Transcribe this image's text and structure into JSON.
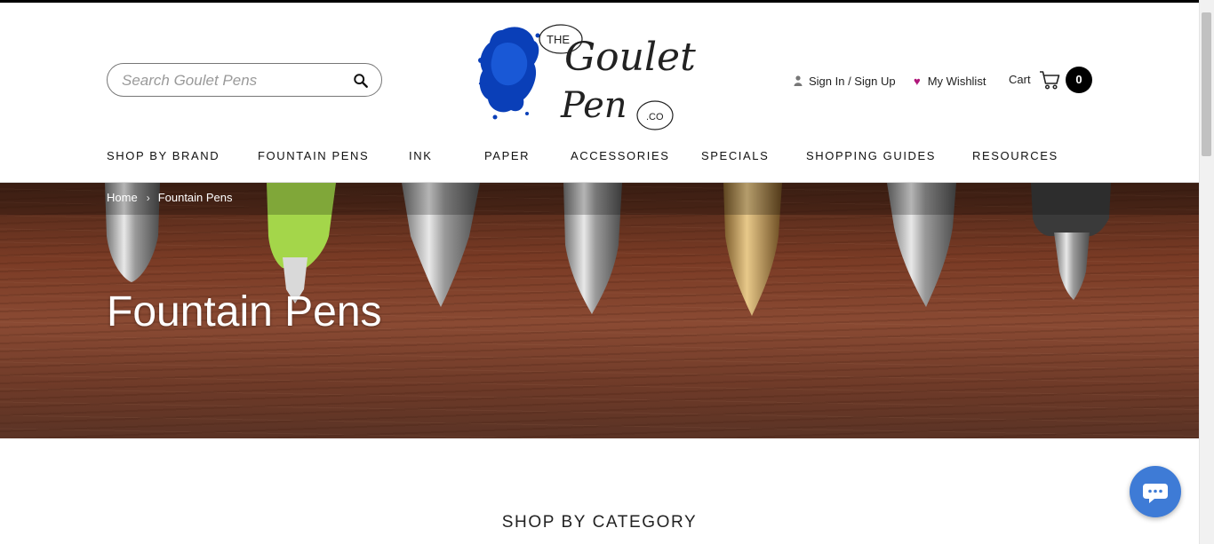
{
  "search": {
    "placeholder": "Search Goulet Pens"
  },
  "logo": {
    "alt": "The Goulet Pen Co"
  },
  "header": {
    "account_label": "Sign In / Sign Up",
    "wishlist_label": "My Wishlist",
    "cart_label": "Cart",
    "cart_count": "0"
  },
  "nav": {
    "items": [
      {
        "label": "SHOP BY BRAND"
      },
      {
        "label": "FOUNTAIN PENS"
      },
      {
        "label": "INK"
      },
      {
        "label": "PAPER"
      },
      {
        "label": "ACCESSORIES"
      },
      {
        "label": "SPECIALS"
      },
      {
        "label": "SHOPPING GUIDES"
      },
      {
        "label": "RESOURCES"
      }
    ]
  },
  "breadcrumb": {
    "home": "Home",
    "current": "Fountain Pens"
  },
  "hero": {
    "title": "Fountain Pens"
  },
  "section": {
    "title": "SHOP BY CATEGORY"
  },
  "colors": {
    "wishlist_heart": "#b0177a",
    "chat_button": "#3e7bd6",
    "logo_ink": "#0a3fb8"
  },
  "icons": [
    "search-icon",
    "user-icon",
    "heart-icon",
    "cart-icon",
    "chat-icon",
    "chevron-right-icon"
  ]
}
